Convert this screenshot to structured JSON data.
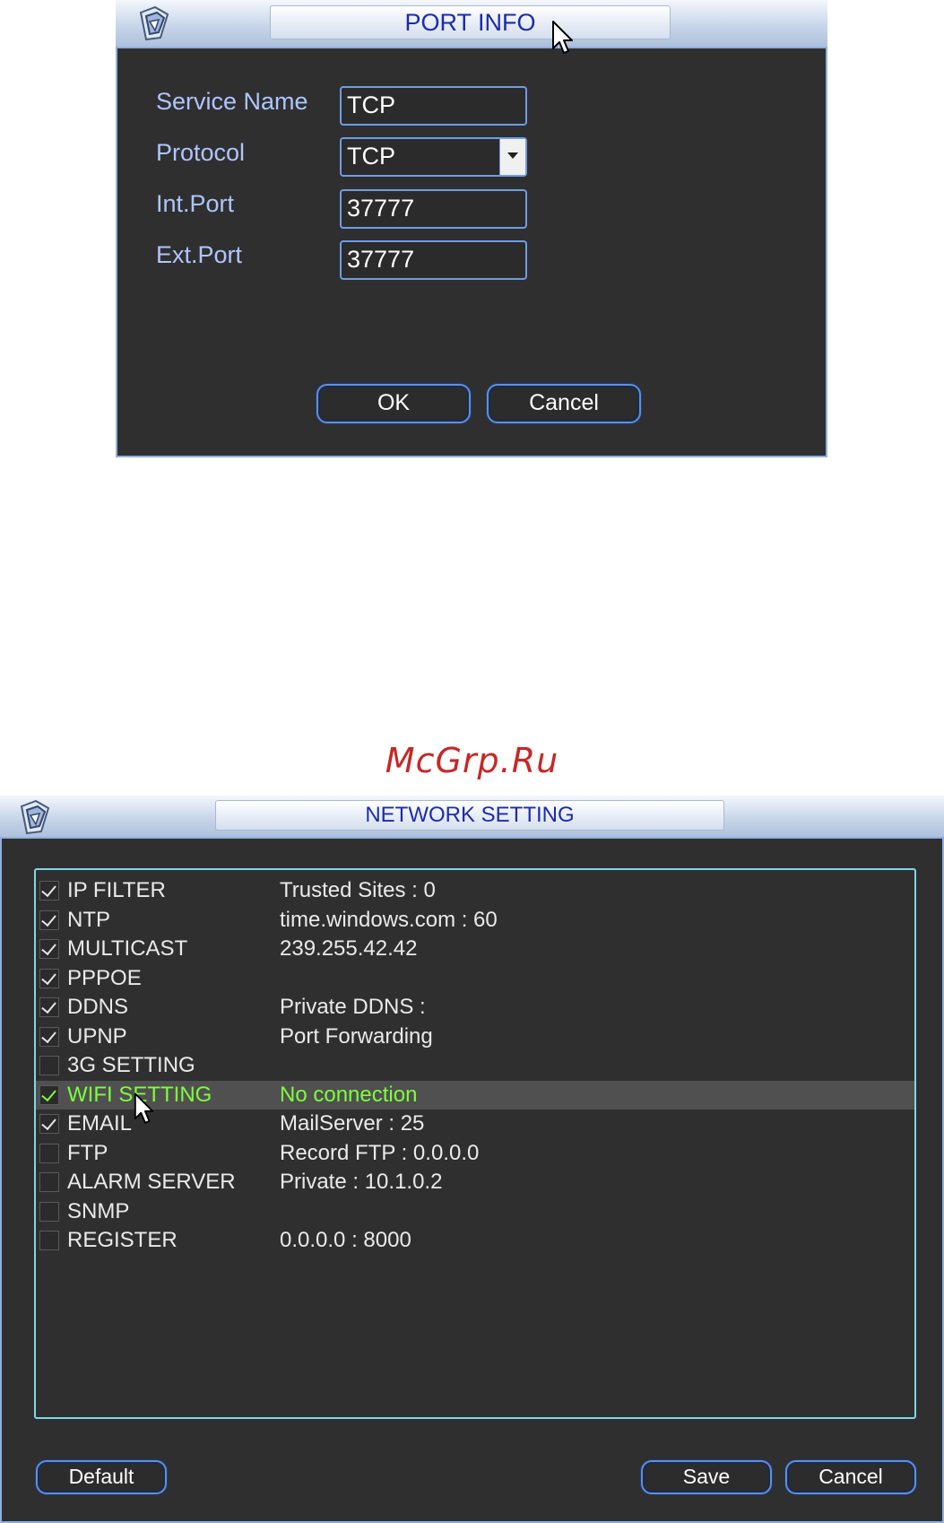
{
  "port_info": {
    "title": "PORT INFO",
    "fields": {
      "service_name": {
        "label": "Service Name",
        "value": "TCP"
      },
      "protocol": {
        "label": "Protocol",
        "value": "TCP"
      },
      "int_port": {
        "label": "Int.Port",
        "value": "37777"
      },
      "ext_port": {
        "label": "Ext.Port",
        "value": "37777"
      }
    },
    "ok_label": "OK",
    "cancel_label": "Cancel"
  },
  "watermark": "McGrp.Ru",
  "network_setting": {
    "title": "NETWORK SETTING",
    "items": [
      {
        "name": "IP FILTER",
        "value": "Trusted Sites : 0",
        "checked": true
      },
      {
        "name": "NTP",
        "value": "time.windows.com : 60",
        "checked": true
      },
      {
        "name": "MULTICAST",
        "value": "239.255.42.42",
        "checked": true
      },
      {
        "name": "PPPOE",
        "value": "",
        "checked": true
      },
      {
        "name": "DDNS",
        "value": "Private DDNS :",
        "checked": true
      },
      {
        "name": "UPNP",
        "value": "Port Forwarding",
        "checked": true
      },
      {
        "name": "3G SETTING",
        "value": "",
        "checked": false
      },
      {
        "name": "WIFI SETTING",
        "value": "No connection",
        "checked": true,
        "selected": true
      },
      {
        "name": "EMAIL",
        "value": "MailServer : 25",
        "checked": true
      },
      {
        "name": "FTP",
        "value": "Record FTP : 0.0.0.0",
        "checked": false
      },
      {
        "name": "ALARM SERVER",
        "value": "Private : 10.1.0.2",
        "checked": false
      },
      {
        "name": "SNMP",
        "value": "",
        "checked": false
      },
      {
        "name": "REGISTER",
        "value": "0.0.0.0 : 8000",
        "checked": false
      }
    ],
    "default_label": "Default",
    "save_label": "Save",
    "cancel_label": "Cancel"
  },
  "colors": {
    "panel_bg": "#2f2f2f",
    "label_blue": "#aec6ff",
    "title_text": "#1c2bb0",
    "selected_green": "#7cff3c",
    "list_border": "#7fd8e8",
    "watermark_red": "#c62828"
  },
  "icons": [
    "app-logo-icon",
    "mouse-cursor-icon",
    "dropdown-arrow-icon",
    "checkbox-icon"
  ]
}
